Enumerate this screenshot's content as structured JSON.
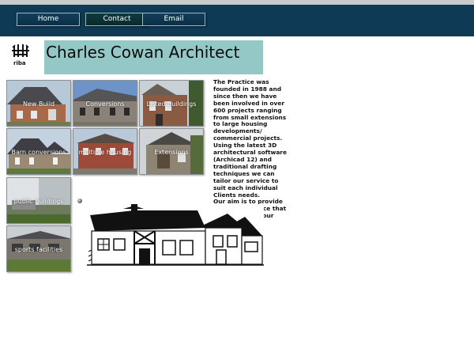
{
  "nav": {
    "home": "Home",
    "contact": "Contact",
    "email": "Email"
  },
  "logo": {
    "text": "riba"
  },
  "title": "Charles Cowan Architect",
  "tiles": [
    {
      "label": "New Build"
    },
    {
      "label": "Conversions"
    },
    {
      "label": "Listed buildings"
    },
    {
      "label": "Barn conversions"
    },
    {
      "label": "multiple housing"
    },
    {
      "label": "Extensions"
    },
    {
      "label": "public buildings"
    },
    {
      "label": "sports facilities"
    }
  ],
  "intro": {
    "paragraph1": "The Practice was founded in 1988 and since then we have been involved in over 600 projects ranging from small extensions to large housing developments/ commercial projects. Using the latest 3D architectural software (Archicad 12) and traditional drafting techniques we can tailor our service to suit each individual Clients needs.",
    "paragraph2": "Our aim is to provide a friendly service that addresses all your design needs."
  },
  "colors": {
    "navbar": "#0e3a55",
    "title_banner": "#93c8c6",
    "accent_active": "#0f3a3d"
  }
}
